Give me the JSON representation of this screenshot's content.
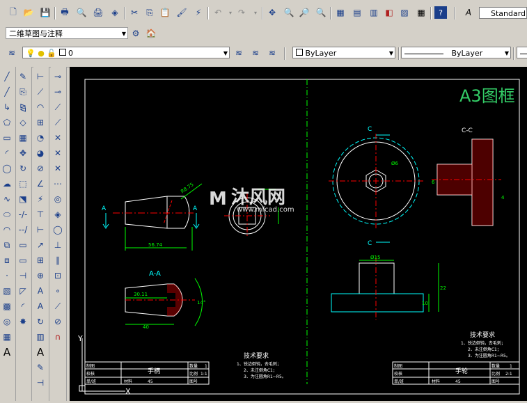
{
  "toolbar": {
    "text_style": "Standard"
  },
  "workspace": {
    "value": "二维草图与注释"
  },
  "layers": {
    "current_layer": "0",
    "color": "ByLayer",
    "linetype": "ByLayer"
  },
  "drawing": {
    "frame_title": "A3图框",
    "watermark_name": "沐风网",
    "watermark_url": "www.mfcad.com",
    "left_part": {
      "section_label": "A-A",
      "section_marker": "A",
      "dim_length": "56.74",
      "dim_radius": "R8.75",
      "dim_30": "30.11",
      "dim_40": "40",
      "dim_angle": "14°"
    },
    "right_part": {
      "section_label": "C-C",
      "section_marker": "C",
      "dim_diam6": "Ø6",
      "dim_diam15": "Ø15",
      "dim_22": "22",
      "dim_10": "10",
      "dim_4": "4",
      "dim_6": "6"
    },
    "left_notes": {
      "heading": "技术要求",
      "lines": [
        "1、锐边倒钝，去毛刺；",
        "2、未注倒角C1；",
        "3、为注圆角R1~R5。"
      ]
    },
    "right_notes": {
      "heading": "技术要求",
      "lines": [
        "1、锐边倒钝，去毛刺；",
        "2、未注倒角C1；",
        "3、为注圆角R1~R5。"
      ]
    },
    "left_titleblock": {
      "row1": "制图",
      "row2": "校核",
      "row3": "单/班",
      "part_name": "手柄",
      "qty_label": "数量",
      "qty": "1",
      "scale_label": "比例",
      "scale": "1:1",
      "material_label": "材料",
      "material": "45",
      "drawing_no_label": "图号"
    },
    "right_titleblock": {
      "row1": "制图",
      "row2": "校核",
      "row3": "单/班",
      "part_name": "手轮",
      "qty_label": "数量",
      "qty": "1",
      "scale_label": "比例",
      "scale": "2:1",
      "material_label": "材料",
      "material": "45",
      "drawing_no_label": "图号"
    },
    "ucs_y": "Y",
    "ucs_x": "X"
  },
  "colors": {
    "canvas": "#000000",
    "green": "#00ff00",
    "cyan": "#00ffff",
    "red": "#ff0000",
    "white": "#ffffff",
    "title_green": "#33cc66"
  }
}
